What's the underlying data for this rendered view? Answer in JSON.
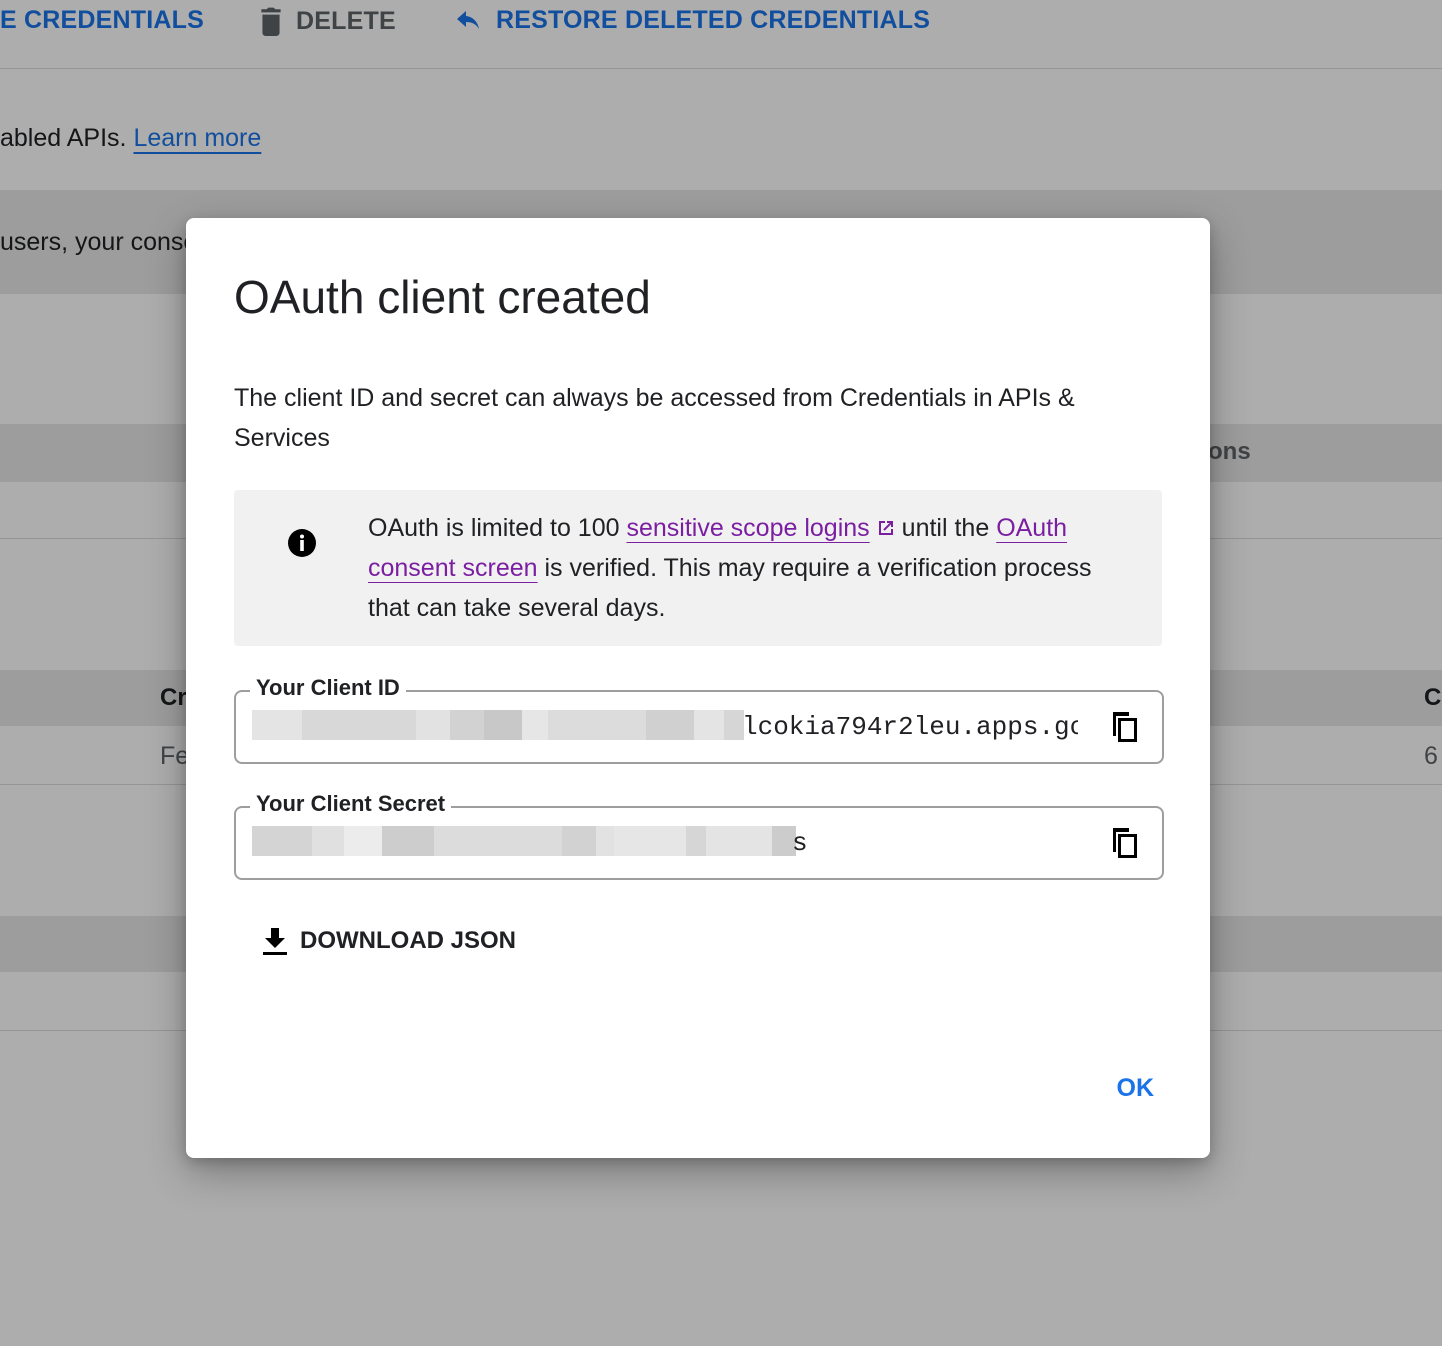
{
  "background": {
    "toolbar": {
      "create_label": "E CREDENTIALS",
      "delete_label": "DELETE",
      "restore_label": "RESTORE DELETED CREDENTIALS"
    },
    "intro_text": "abled APIs.",
    "learn_more": "Learn more",
    "consent_text": "users, your conse",
    "col_fragment_right": "ons",
    "col_fragment_left": "Cr",
    "col_fragment_far_right": "C",
    "cell_fragment_left": "Fe",
    "cell_fragment_far_right": "6"
  },
  "dialog": {
    "title": "OAuth client created",
    "description": "The client ID and secret can always be accessed from Credentials in APIs & Services",
    "notice": {
      "prefix": "OAuth is limited to 100",
      "link1": "sensitive scope logins",
      "middle": "until the",
      "link2": "OAuth consent screen",
      "suffix": "is verified. This may require a verification process that can take several days."
    },
    "client_id": {
      "label": "Your Client ID",
      "visible_tail": "lcokia794r2leu.apps.gc"
    },
    "client_secret": {
      "label": "Your Client Secret",
      "visible_tail": "s"
    },
    "download_label": "DOWNLOAD JSON",
    "ok_label": "OK"
  },
  "colors": {
    "accent_blue": "#1a73e8",
    "link_purple": "#7b1fa2",
    "scrim": "rgba(0,0,0,0.32)"
  },
  "icons": [
    "delete-icon",
    "restore-icon",
    "info-icon",
    "external-link-icon",
    "copy-icon",
    "download-icon"
  ]
}
